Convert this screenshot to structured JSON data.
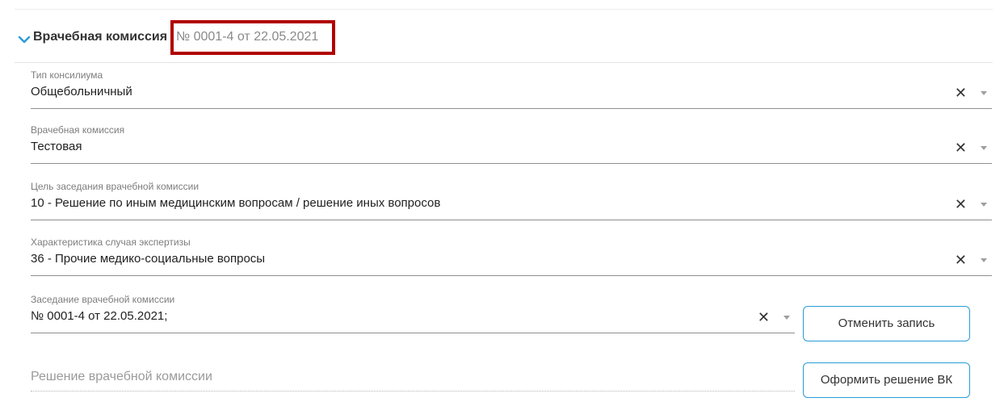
{
  "section": {
    "title": "Врачебная комиссия",
    "number": "№ 0001-4 от 22.05.2021",
    "chevron_icon": "chevron-down-icon",
    "accent_color": "#2a9bd6",
    "highlight_color": "#b00000"
  },
  "fields": [
    {
      "label": "Тип консилиума",
      "value": "Общебольничный"
    },
    {
      "label": "Врачебная комиссия",
      "value": "Тестовая"
    },
    {
      "label": "Цель заседания врачебной комиссии",
      "value": "10 - Решение по иным медицинским вопросам / решение иных вопросов"
    },
    {
      "label": "Характеристика случая экспертизы",
      "value": "36 - Прочие медико-социальные вопросы"
    },
    {
      "label": "Заседание врачебной комиссии",
      "value": "№ 0001-4 от 22.05.2021;"
    }
  ],
  "icons": {
    "clear": "✕",
    "dropdown": "caret-down-icon"
  },
  "buttons": {
    "cancel_record": "Отменить запись",
    "make_decision": "Оформить решение ВК"
  },
  "decision": {
    "placeholder": "Решение врачебной комиссии"
  }
}
